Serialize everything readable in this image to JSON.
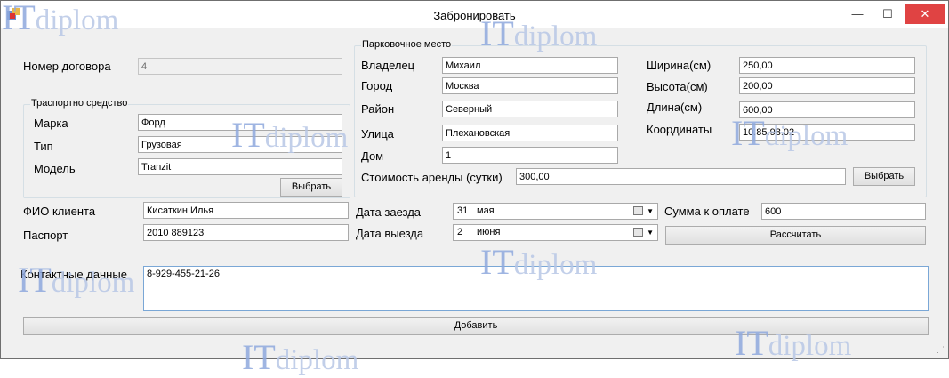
{
  "window": {
    "title": "Забронировать",
    "minimize_glyph": "—",
    "maximize_glyph": "☐",
    "close_glyph": "✕"
  },
  "contract": {
    "label": "Номер договора",
    "value": "4"
  },
  "vehicle": {
    "caption": "Траспортно средство",
    "brand_label": "Марка",
    "brand": "Форд",
    "type_label": "Тип",
    "type": "Грузовая",
    "model_label": "Модель",
    "model": "Tranzit",
    "select_button": "Выбрать"
  },
  "parking": {
    "caption": "Парковочное место",
    "owner_label": "Владелец",
    "owner": "Михаил",
    "city_label": "Город",
    "city": "Москва",
    "district_label": "Район",
    "district": "Северный",
    "street_label": "Улица",
    "street": "Плехановская",
    "house_label": "Дом",
    "house": "1",
    "width_label": "Ширина(см)",
    "width": "250,00",
    "height_label": "Высота(см)",
    "height": "200,00",
    "length_label": "Длина(см)",
    "length": "600,00",
    "coords_label": "Координаты",
    "coords": "10.85.98.02",
    "rent_label": "Стоимость аренды (сутки)",
    "rent": "300,00",
    "select_button": "Выбрать"
  },
  "client": {
    "name_label": "ФИО клиента",
    "name": "Кисаткин Илья",
    "passport_label": "Паспорт",
    "passport": "2010 889123",
    "contacts_label": "Контактные данные",
    "contacts": "8-929-455-21-26"
  },
  "dates": {
    "checkin_label": "Дата заезда",
    "checkin_day": "31",
    "checkin_month": "мая",
    "checkout_label": "Дата выезда",
    "checkout_day": "2",
    "checkout_month": "июня"
  },
  "payment": {
    "label": "Сумма к оплате",
    "value": "600",
    "calc_button": "Рассчитать"
  },
  "add_button": "Добавить",
  "watermark": {
    "it": "IT",
    "rest": "diplom"
  }
}
